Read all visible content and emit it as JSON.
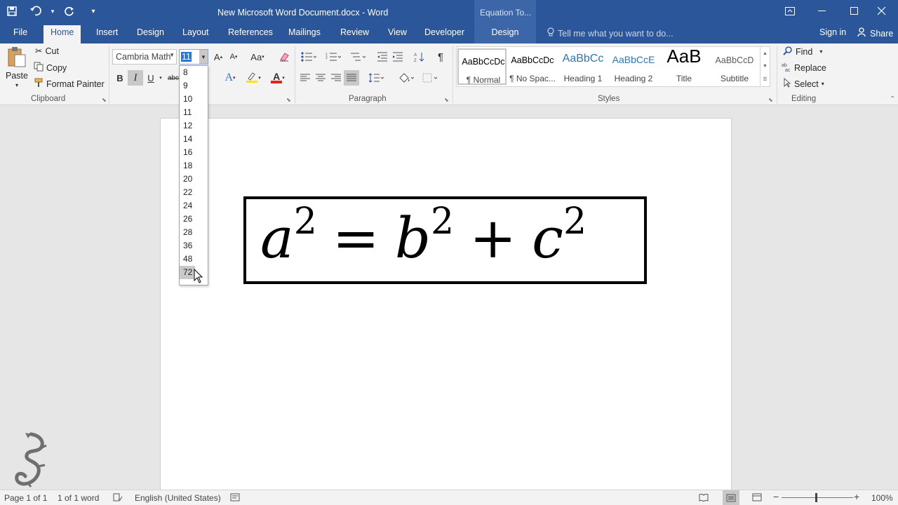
{
  "window": {
    "title": "New Microsoft Word Document.docx - Word",
    "context_group": "Equation To...",
    "controls": [
      "ribbon-display-icon",
      "minimize-icon",
      "maximize-icon",
      "close-icon"
    ]
  },
  "qat": {
    "icons": [
      "save-icon",
      "undo-icon",
      "redo-icon",
      "customize-qat-icon"
    ]
  },
  "tabs": [
    {
      "label": "File"
    },
    {
      "label": "Home"
    },
    {
      "label": "Insert"
    },
    {
      "label": "Design"
    },
    {
      "label": "Layout"
    },
    {
      "label": "References"
    },
    {
      "label": "Mailings"
    },
    {
      "label": "Review"
    },
    {
      "label": "View"
    },
    {
      "label": "Developer"
    },
    {
      "label": "Design"
    }
  ],
  "active_tab": "Home",
  "tellme": {
    "placeholder": "Tell me what you want to do..."
  },
  "account": {
    "signin": "Sign in",
    "share": "Share"
  },
  "clipboard": {
    "paste": "Paste",
    "cut": "Cut",
    "copy": "Copy",
    "format_painter": "Format Painter",
    "label": "Clipboard"
  },
  "font": {
    "family": "Cambria Math",
    "size": "11",
    "grow_icon": "grow-font-icon",
    "shrink_icon": "shrink-font-icon",
    "change_case": "Aa",
    "bold": "B",
    "italic": "I",
    "underline": "U",
    "strike": "abc",
    "font_color_letter": "A",
    "effects_letter": "A",
    "colors": {
      "highlight": "#f5e418",
      "font_color": "#e1251b",
      "effects": "#2b76cf"
    },
    "italic_active": true
  },
  "font_size_dropdown": {
    "options": [
      "8",
      "9",
      "10",
      "11",
      "12",
      "14",
      "16",
      "18",
      "20",
      "22",
      "24",
      "26",
      "28",
      "36",
      "48",
      "72"
    ],
    "hovered": "72"
  },
  "paragraph": {
    "label": "Paragraph"
  },
  "styles": {
    "label": "Styles",
    "items": [
      {
        "preview": "AaBbCcDc",
        "name": "¶ Normal",
        "color": "#000000"
      },
      {
        "preview": "AaBbCcDc",
        "name": "¶ No Spac...",
        "color": "#000000"
      },
      {
        "preview": "AaBbCc",
        "name": "Heading 1",
        "color": "#2e74b5"
      },
      {
        "preview": "AaBbCcE",
        "name": "Heading 2",
        "color": "#2e74b5"
      },
      {
        "preview": "AaB",
        "name": "Title",
        "color": "#000000"
      },
      {
        "preview": "AaBbCcD",
        "name": "Subtitle",
        "color": "#5a5a5a"
      }
    ],
    "selected": "¶ Normal"
  },
  "editing": {
    "label": "Editing",
    "find": "Find",
    "replace": "Replace",
    "select": "Select"
  },
  "equation": {
    "a": "a",
    "b": "b",
    "c": "c",
    "exp": "2",
    "eq": "=",
    "plus": "+"
  },
  "status": {
    "page": "Page 1 of 1",
    "words": "1 of 1 word",
    "language": "English (United States)",
    "zoom": "100%",
    "zoom_minus": "−",
    "zoom_plus": "+"
  },
  "colors": {
    "accent": "#2b579a"
  }
}
